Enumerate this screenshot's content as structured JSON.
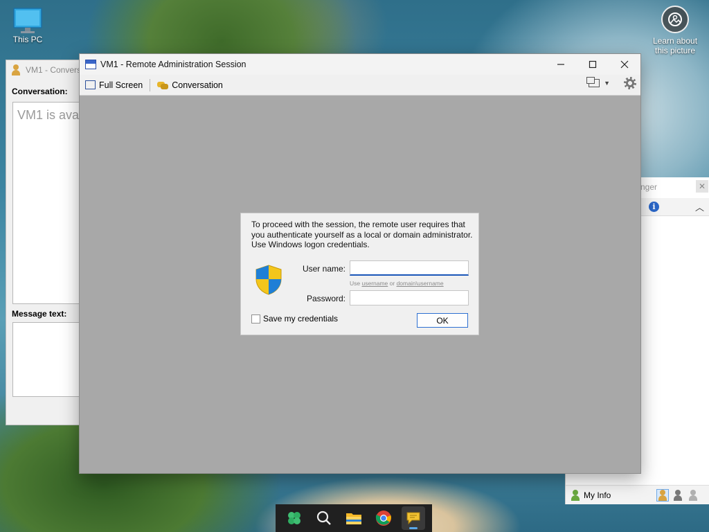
{
  "desktop": {
    "this_pc_label": "This PC",
    "learn_label": "Learn about this picture"
  },
  "conversation_window": {
    "title": "VM1 - Convers",
    "conversation_label": "Conversation:",
    "conversation_text": "VM1 is ava",
    "message_label": "Message text:"
  },
  "messenger_window": {
    "title": "nger",
    "my_info_label": "My Info"
  },
  "main_window": {
    "title": "VM1 - Remote Administration Session",
    "toolbar": {
      "full_screen_label": "Full Screen",
      "conversation_label": "Conversation"
    }
  },
  "auth_dialog": {
    "message": "To proceed with the session, the remote user requires that you authenticate yourself as a local or domain administrator. Use Windows logon credentials.",
    "username_label": "User name:",
    "username_value": "",
    "hint_prefix": "Use ",
    "hint_username": "username",
    "hint_middle": " or ",
    "hint_domain": "domain\\username",
    "password_label": "Password:",
    "password_value": "",
    "save_credentials_label": "Save my credentials",
    "ok_label": "OK"
  },
  "taskbar": {
    "apps": [
      "start",
      "search",
      "file-explorer",
      "chrome",
      "remote-admin"
    ]
  },
  "colors": {
    "accent": "#1a56b8",
    "session_background": "#a8a8a8",
    "taskbar": "#202020"
  }
}
